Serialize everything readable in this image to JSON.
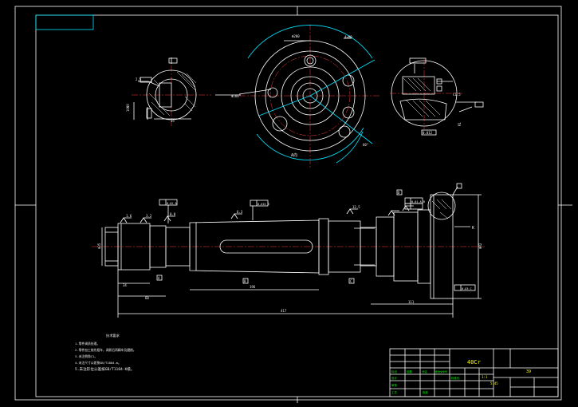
{
  "view_label_a": "A向",
  "section_label": "K",
  "tech_requirements": {
    "title": "技术要求",
    "items": [
      "1.零件调质处理。",
      "2.零件加工前先粗车，调质后再精车及磨削。",
      "3.未注倒角C1。",
      "4.未注尺寸公差按GB/T1804-m。",
      "5.未注形位公差按GB/T1184-K级。"
    ]
  },
  "title_block": {
    "material": "40Cr",
    "scale": "1:1",
    "sheet_number": "39",
    "weight": "5.45",
    "row_labels": [
      "标记",
      "处数",
      "分区",
      "更改文件号",
      "签名",
      "年月日"
    ],
    "design_labels": [
      "设计",
      "审核",
      "工艺",
      "标准化",
      "批准"
    ]
  },
  "dimensions": {
    "total_length": "417",
    "shaft_length": "196",
    "left_len_1": "34",
    "left_len_2": "60",
    "right_len": "111",
    "diameter_main": "Φ82",
    "diameter_left": "Φ35",
    "flange_dia": "Φ200",
    "bolt_circle": "Φ160"
  },
  "roughness": [
    "1.6",
    "3.2",
    "0.8",
    "6.3",
    "12.5"
  ],
  "datum_labels": [
    "A",
    "B",
    "C",
    "D"
  ],
  "tolerances": [
    "0.02 A",
    "0.015 B",
    "0.01 A-B",
    "0.03 C"
  ]
}
